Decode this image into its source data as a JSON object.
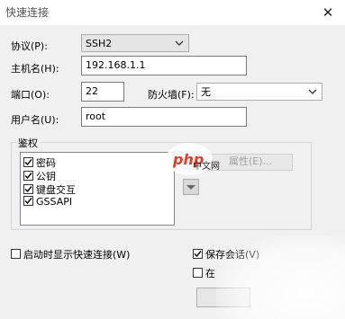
{
  "window": {
    "title": "快速连接",
    "close_glyph": "✕"
  },
  "form": {
    "protocol": {
      "label": "协议(P):",
      "value": "SSH2"
    },
    "hostname": {
      "label": "主机名(H):",
      "value": "192.168.1.1"
    },
    "port": {
      "label": "端口(O):",
      "value": "22"
    },
    "firewall": {
      "label": "防火墙(F):",
      "value": "无"
    },
    "username": {
      "label": "用户名(U):",
      "value": "root"
    }
  },
  "auth": {
    "title": "鉴权",
    "items": [
      {
        "label": "密码",
        "checked": true
      },
      {
        "label": "公钥",
        "checked": true
      },
      {
        "label": "键盘交互",
        "checked": true
      },
      {
        "label": "GSSAPI",
        "checked": true
      }
    ],
    "properties_button": "属性(E)..."
  },
  "options": {
    "show_on_startup": {
      "label": "启动时显示快速连接(W)",
      "checked": false
    },
    "save_session": {
      "label": "保存会话(V)",
      "checked": true
    },
    "open_in_tab": {
      "label": "在",
      "checked": false
    }
  },
  "watermark": {
    "text": "php中文网"
  }
}
